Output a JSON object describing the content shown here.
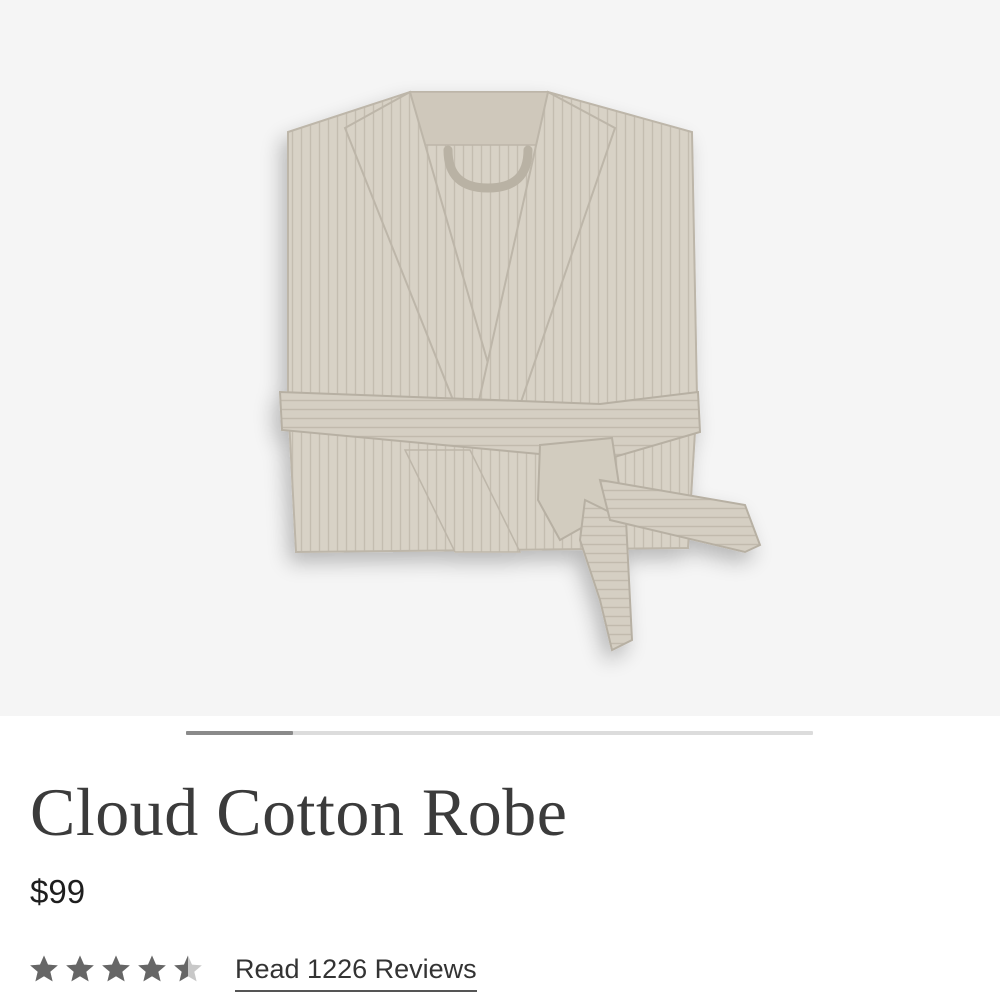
{
  "product": {
    "name": "Cloud Cotton Robe",
    "price": "$99",
    "rating": 4.5,
    "rating_max": 5,
    "reviews_link_label": "Read 1226 Reviews"
  },
  "image": {
    "subject": "robe-photo",
    "background_color": "#f5f5f5",
    "robe_color": "#d8d2c6"
  },
  "carousel": {
    "progress": 0.17
  },
  "colors": {
    "star_fill": "#666666",
    "star_empty": "#c8c8c8",
    "title": "#3b3b3b"
  }
}
